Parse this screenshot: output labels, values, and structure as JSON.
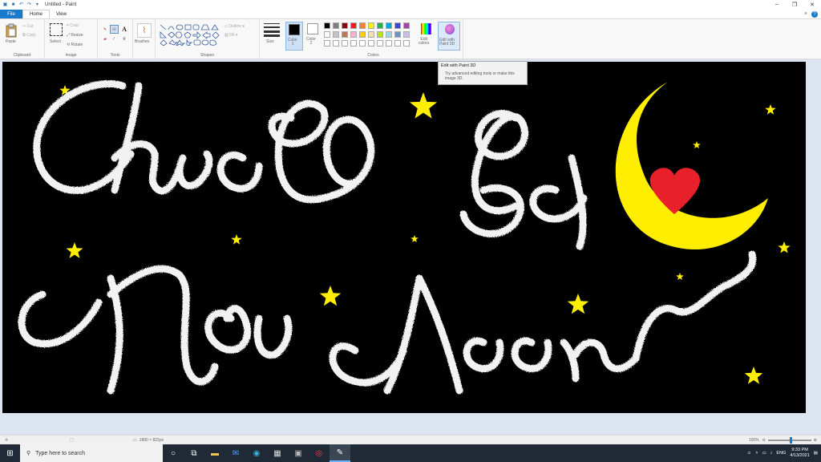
{
  "window": {
    "title": "Untitled - Paint",
    "help": "?"
  },
  "tabs": [
    {
      "label": "File"
    },
    {
      "label": "Home"
    },
    {
      "label": "View"
    }
  ],
  "ribbon": {
    "clipboard": {
      "paste": "Paste",
      "cut": "Cut",
      "copy": "Copy",
      "label": "Clipboard"
    },
    "image": {
      "select": "Select",
      "crop": "Crop",
      "resize": "Resize",
      "rotate": "Rotate",
      "label": "Image"
    },
    "tools": {
      "label": "Tools"
    },
    "brushes": {
      "label": "Brushes"
    },
    "shapes": {
      "outline": "Outline",
      "fill": "Fill",
      "label": "Shapes"
    },
    "size": {
      "label": "Size"
    },
    "colors": {
      "color1": "Color\n1",
      "color2": "Color\n2",
      "edit_colors": "Edit\ncolors",
      "edit_paint3d": "Edit with\nPaint 3D",
      "label": "Colors",
      "color1_value": "#000000",
      "color2_value": "#ffffff",
      "palette": [
        "#000000",
        "#7f7f7f",
        "#880015",
        "#ed1c24",
        "#ff7f27",
        "#fff200",
        "#22b14c",
        "#00a2e8",
        "#3f48cc",
        "#a349a4",
        "#ffffff",
        "#c3c3c3",
        "#b97a57",
        "#ffaec9",
        "#ffc90e",
        "#efe4b0",
        "#b5e61d",
        "#99d9ea",
        "#7092be",
        "#c8bfe7"
      ]
    }
  },
  "tooltip": {
    "title": "Edit with Paint 3D",
    "body": "Try advanced editing tools or make this image 3D."
  },
  "canvas": {
    "background": "#000000",
    "text_lines": [
      "Chúc Bé",
      "Ngủ Ngon"
    ],
    "moon_color": "#ffee00",
    "heart_color": "#e8202a",
    "star_color": "#ffee00"
  },
  "status": {
    "dimensions": "1880 × 822px",
    "zoom": "100%"
  },
  "taskbar": {
    "search_placeholder": "Type here to search",
    "lang": "ENG",
    "time": "9:33 PM",
    "date": "4/13/2021"
  }
}
